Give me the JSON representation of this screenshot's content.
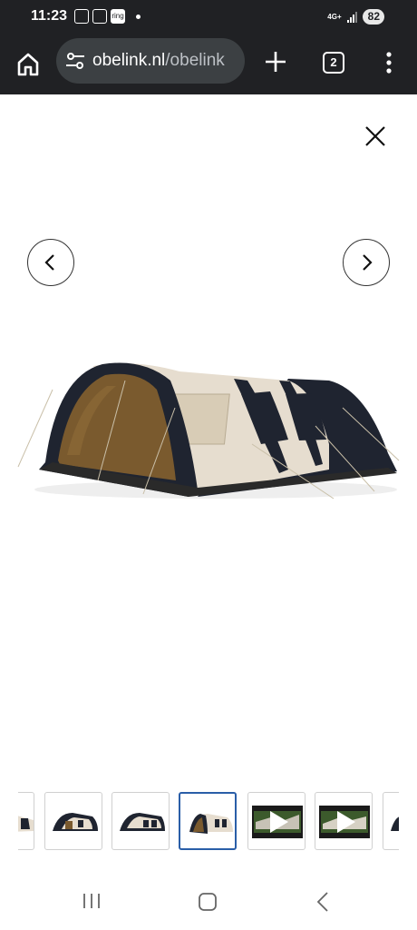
{
  "status_bar": {
    "time": "11:23",
    "network": "4G+",
    "battery": "82",
    "ring_label": "ring"
  },
  "browser": {
    "url_domain": "obelink.nl",
    "url_path": "/obelink",
    "tab_count": "2"
  },
  "gallery": {
    "thumbnails": [
      {
        "kind": "image",
        "active": false
      },
      {
        "kind": "image",
        "active": false
      },
      {
        "kind": "image",
        "active": false
      },
      {
        "kind": "image",
        "active": true
      },
      {
        "kind": "video",
        "active": false
      },
      {
        "kind": "video",
        "active": false
      },
      {
        "kind": "image",
        "active": false
      }
    ]
  },
  "icons": {
    "home": "home-icon",
    "site_settings": "tune-icon",
    "new_tab": "plus-icon",
    "menu": "more-vert-icon",
    "close": "close-icon",
    "prev": "chevron-left-icon",
    "next": "chevron-right-icon"
  },
  "colors": {
    "chrome_dark": "#202124",
    "url_bar": "#3c4043",
    "active_thumb_border": "#2a5ea8",
    "tent_beige": "#e6ddcf",
    "tent_dark": "#1f2430"
  }
}
